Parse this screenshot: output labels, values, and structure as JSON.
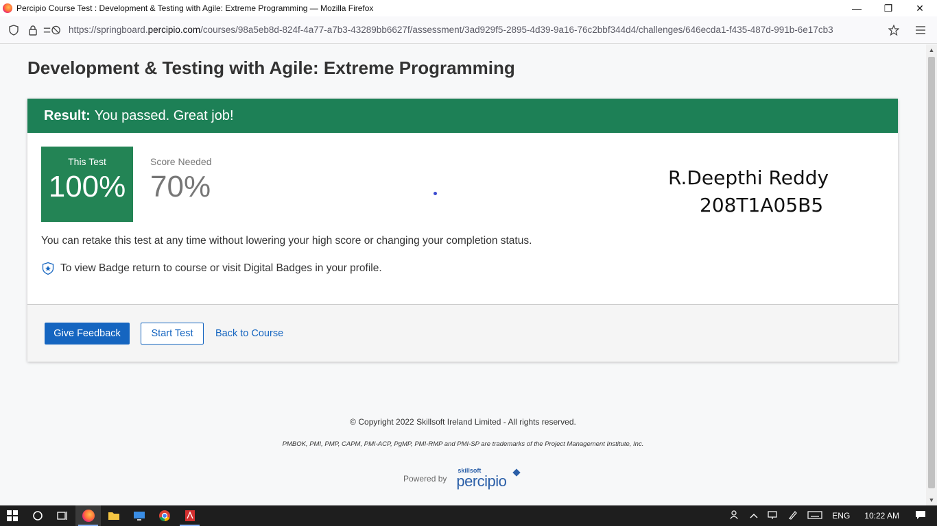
{
  "window": {
    "title": "Percipio Course Test : Development & Testing with Agile: Extreme Programming — Mozilla Firefox",
    "minimize": "—",
    "restore": "❐",
    "close": "✕"
  },
  "address_bar": {
    "url_prefix": "https://springboard.",
    "url_host": "percipio.com",
    "url_path": "/courses/98a5eb8d-824f-4a77-a7b3-43289bb6627f/assessment/3ad929f5-2895-4d39-9a16-76c2bbf344d4/challenges/646ecda1-f435-487d-991b-6e17cb3"
  },
  "page": {
    "title": "Development & Testing with Agile: Extreme Programming",
    "result_label": "Result:",
    "result_text": "You passed. Great job!",
    "this_test_label": "This Test",
    "this_test_value": "100%",
    "score_needed_label": "Score Needed",
    "score_needed_value": "70%",
    "handwritten_name": "R.Deepthi Reddy",
    "handwritten_id": "208T1A05B5",
    "retake_text": "You can retake this test at any time without lowering your high score or changing your completion status.",
    "badge_text": "To view Badge return to course or visit Digital Badges in your profile.",
    "buttons": {
      "feedback": "Give Feedback",
      "start": "Start Test",
      "back": "Back to Course"
    }
  },
  "footer": {
    "copyright": "© Copyright 2022 Skillsoft Ireland Limited - All rights reserved.",
    "trademark": "PMBOK, PMI, PMP, CAPM, PMI-ACP, PgMP, PMI-RMP and PMI-SP are trademarks of the Project Management Institute, Inc.",
    "powered_by": "Powered by",
    "logo_small": "skillsoft",
    "logo_main": "percipio"
  },
  "taskbar": {
    "language": "ENG",
    "time": "10:22 AM"
  },
  "colors": {
    "result_green": "#1d8056",
    "score_green": "#238455",
    "link_blue": "#1565c0"
  }
}
